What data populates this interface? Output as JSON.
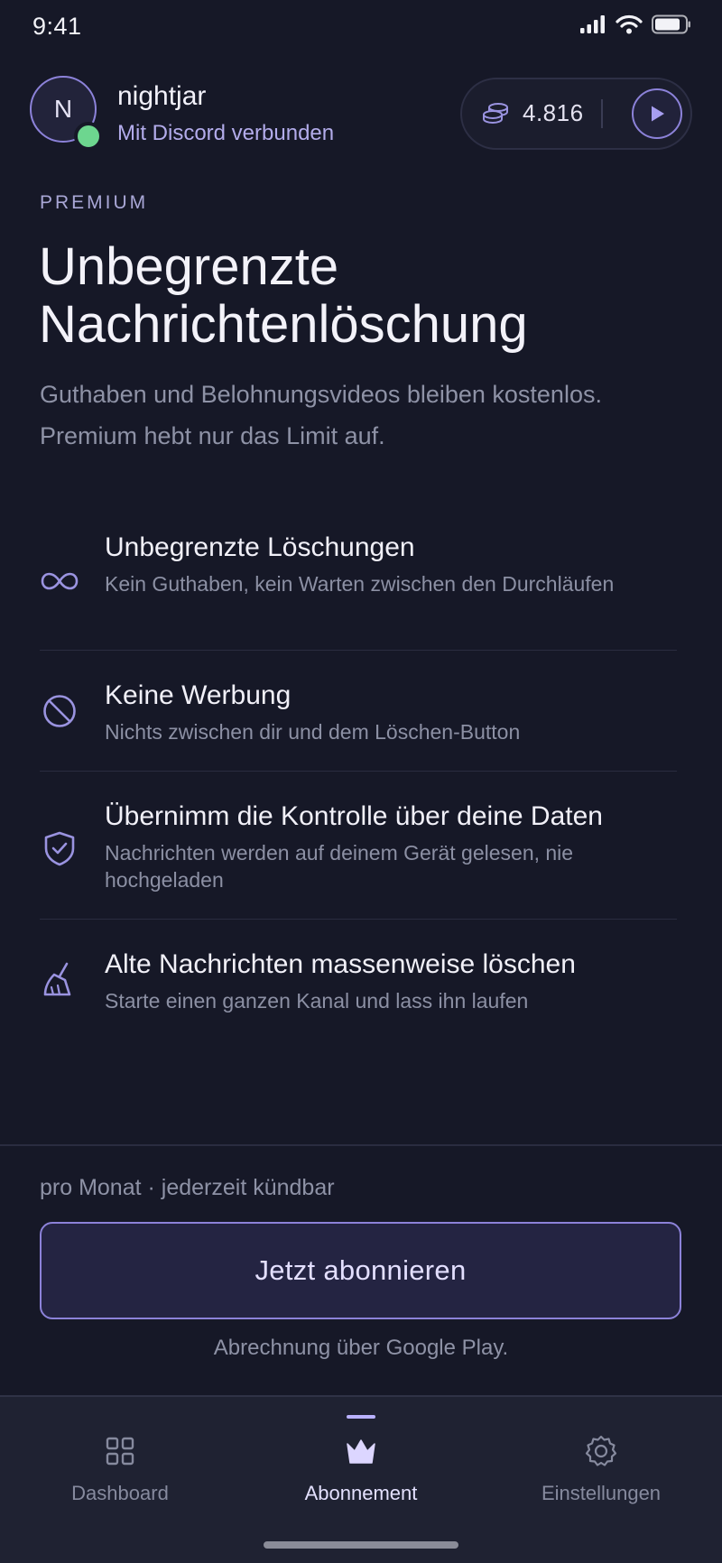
{
  "status_bar": {
    "time": "9:41"
  },
  "header": {
    "avatar_initial": "N",
    "username": "nightjar",
    "connection_status": "Mit Discord verbunden",
    "credits": "4.816"
  },
  "hero": {
    "eyebrow": "PREMIUM",
    "headline_line1": "Unbegrenzte",
    "headline_line2": "Nachrichtenlöschung",
    "subtext": "Guthaben und Belohnungsvideos bleiben kostenlos. Premium hebt nur das Limit auf."
  },
  "features": [
    {
      "icon": "infinity-icon",
      "title": "Unbegrenzte Löschungen",
      "desc": "Kein Guthaben, kein Warten zwischen den Durchläufen"
    },
    {
      "icon": "no-ads-icon",
      "title": "Keine Werbung",
      "desc": "Nichts zwischen dir und dem Löschen-Button"
    },
    {
      "icon": "shield-check-icon",
      "title": "Übernimm die Kontrolle über deine Daten",
      "desc": "Nachrichten werden auf deinem Gerät gelesen, nie hochgeladen"
    },
    {
      "icon": "broom-icon",
      "title": "Alte Nachrichten massenweise löschen",
      "desc": "Starte einen ganzen Kanal und lass ihn laufen"
    }
  ],
  "purchase": {
    "price_note": "pro Monat · jederzeit kündbar",
    "subscribe_label": "Jetzt abonnieren",
    "billing_note": "Abrechnung über Google Play."
  },
  "nav": {
    "items": [
      {
        "label": "Dashboard",
        "icon": "grid-icon",
        "active": false
      },
      {
        "label": "Abonnement",
        "icon": "crown-icon",
        "active": true
      },
      {
        "label": "Einstellungen",
        "icon": "gear-icon",
        "active": false
      }
    ]
  },
  "colors": {
    "background": "#161827",
    "accent": "#8C82D9",
    "online": "#6DD68F",
    "nav_background": "#1F2232"
  }
}
